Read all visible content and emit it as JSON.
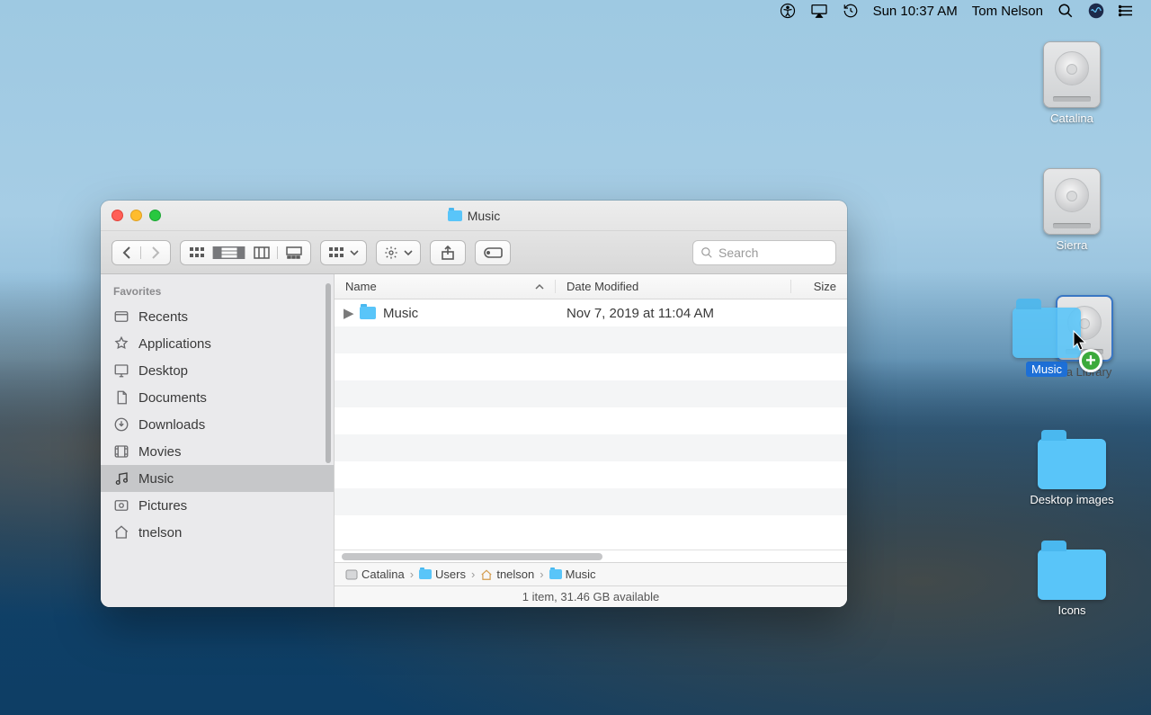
{
  "menubar": {
    "datetime": "Sun 10:37 AM",
    "username": "Tom Nelson"
  },
  "desktop": {
    "items": [
      {
        "kind": "disk",
        "label": "Catalina"
      },
      {
        "kind": "disk",
        "label": "Sierra"
      },
      {
        "kind": "drag",
        "drag_label": "Music",
        "target_label": "dia Library"
      },
      {
        "kind": "folder",
        "label": "Desktop images"
      },
      {
        "kind": "folder",
        "label": "Icons"
      }
    ]
  },
  "finder": {
    "title": "Music",
    "search_placeholder": "Search",
    "sidebar": {
      "header": "Favorites",
      "items": [
        {
          "icon": "recents",
          "label": "Recents"
        },
        {
          "icon": "applications",
          "label": "Applications"
        },
        {
          "icon": "desktop",
          "label": "Desktop"
        },
        {
          "icon": "documents",
          "label": "Documents"
        },
        {
          "icon": "downloads",
          "label": "Downloads"
        },
        {
          "icon": "movies",
          "label": "Movies"
        },
        {
          "icon": "music",
          "label": "Music",
          "selected": true
        },
        {
          "icon": "pictures",
          "label": "Pictures"
        },
        {
          "icon": "home",
          "label": "tnelson"
        }
      ]
    },
    "columns": {
      "name": "Name",
      "date": "Date Modified",
      "size": "Size"
    },
    "rows": [
      {
        "name": "Music",
        "date_modified": "Nov 7, 2019 at 11:04 AM"
      }
    ],
    "pathbar": [
      "Catalina",
      "Users",
      "tnelson",
      "Music"
    ],
    "status": "1 item, 31.46 GB available"
  }
}
